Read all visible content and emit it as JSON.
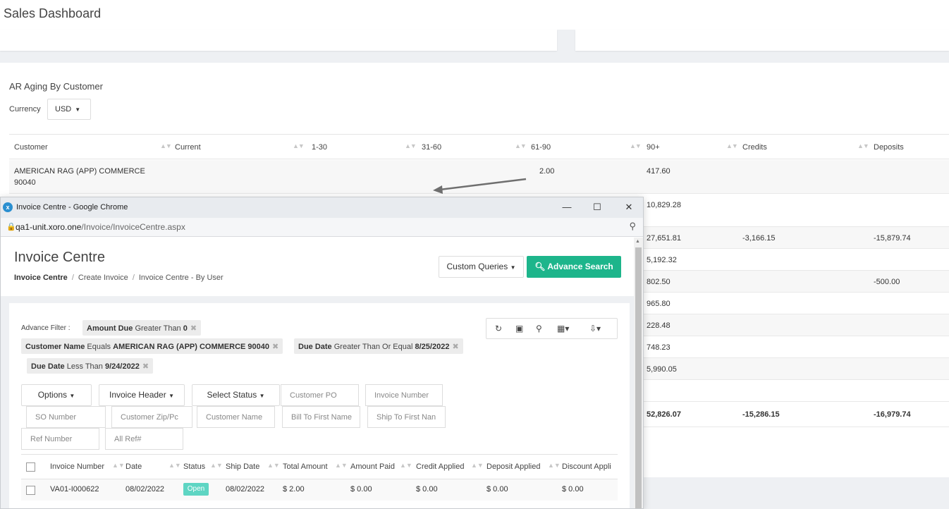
{
  "dashboard": {
    "title": "Sales Dashboard",
    "ar_title": "AR Aging By Customer",
    "currency_label": "Currency",
    "currency_value": "USD",
    "columns": [
      "Customer",
      "Current",
      "1-30",
      "31-60",
      "61-90",
      "90+",
      "Credits",
      "Deposits"
    ],
    "rows": [
      {
        "customer": "AMERICAN RAG (APP) COMMERCE 90040",
        "c6190": "2.00",
        "c90": "417.60",
        "credits": "",
        "deposits": ""
      },
      {
        "customer": "",
        "c6190": "",
        "c90": "10,829.28",
        "credits": "",
        "deposits": ""
      },
      {
        "customer": "",
        "c6190": "",
        "c90": "27,651.81",
        "credits": "-3,166.15",
        "deposits": "-15,879.74"
      },
      {
        "customer": "",
        "c6190": "",
        "c90": "5,192.32",
        "credits": "",
        "deposits": ""
      },
      {
        "customer": "",
        "c6190": "",
        "c90": "802.50",
        "credits": "",
        "deposits": "-500.00"
      },
      {
        "customer": "",
        "c6190": "",
        "c90": "965.80",
        "credits": "",
        "deposits": ""
      },
      {
        "customer": "",
        "c6190": "",
        "c90": "228.48",
        "credits": "",
        "deposits": ""
      },
      {
        "customer": "",
        "c6190": "",
        "c90": "748.23",
        "credits": "",
        "deposits": ""
      },
      {
        "customer": "",
        "c6190": "",
        "c90": "5,990.05",
        "credits": "",
        "deposits": ""
      },
      {
        "customer": "",
        "c6190": "",
        "c90": "",
        "credits": "",
        "deposits": ""
      }
    ],
    "totals": {
      "c90": "52,826.07",
      "credits": "-15,286.15",
      "deposits": "-16,979.74"
    }
  },
  "window": {
    "title": "Invoice Centre - Google Chrome",
    "url_host": "qa1-unit.xoro.one",
    "url_path": "/Invoice/InvoiceCentre.aspx",
    "minimize": "—",
    "maximize": "☐",
    "close": "✕"
  },
  "invoice": {
    "page_title": "Invoice Centre",
    "breadcrumb": [
      "Invoice Centre",
      "Create Invoice",
      "Invoice Centre - By User"
    ],
    "custom_queries": "Custom Queries",
    "advance_search": "Advance Search",
    "advance_filter_label": "Advance Filter :",
    "filters": [
      {
        "field": "Amount Due",
        "op": "Greater Than",
        "value": "0"
      },
      {
        "field": "Customer Name",
        "op": "Equals",
        "value": "AMERICAN RAG (APP) COMMERCE 90040"
      },
      {
        "field": "Due Date",
        "op": "Greater Than Or Equal",
        "value": "8/25/2022"
      },
      {
        "field": "Due Date",
        "op": "Less Than",
        "value": "9/24/2022"
      }
    ],
    "buttons": {
      "options": "Options",
      "invoice_header": "Invoice Header",
      "select_status": "Select Status"
    },
    "placeholders": {
      "customer_po": "Customer PO",
      "invoice_number": "Invoice Number",
      "so_number": "SO Number",
      "customer_zip": "Customer Zip/Pc",
      "customer_name": "Customer Name",
      "bill_to": "Bill To First Name",
      "ship_to": "Ship To First Nan",
      "ref_number": "Ref Number",
      "all_ref": "All Ref#"
    },
    "columns": [
      "Invoice Number",
      "Date",
      "Status",
      "Ship Date",
      "Total Amount",
      "Amount Paid",
      "Credit Applied",
      "Deposit Applied",
      "Discount Appli"
    ],
    "rows": [
      {
        "invoice_number": "VA01-I000622",
        "date": "08/02/2022",
        "status": "Open",
        "ship_date": "08/02/2022",
        "total_amount": "$ 2.00",
        "amount_paid": "$ 0.00",
        "credit_applied": "$ 0.00",
        "deposit_applied": "$ 0.00",
        "discount_applied": "$ 0.00"
      }
    ]
  },
  "colors": {
    "accent": "#1db58b",
    "status_open": "#5ed5c3"
  }
}
